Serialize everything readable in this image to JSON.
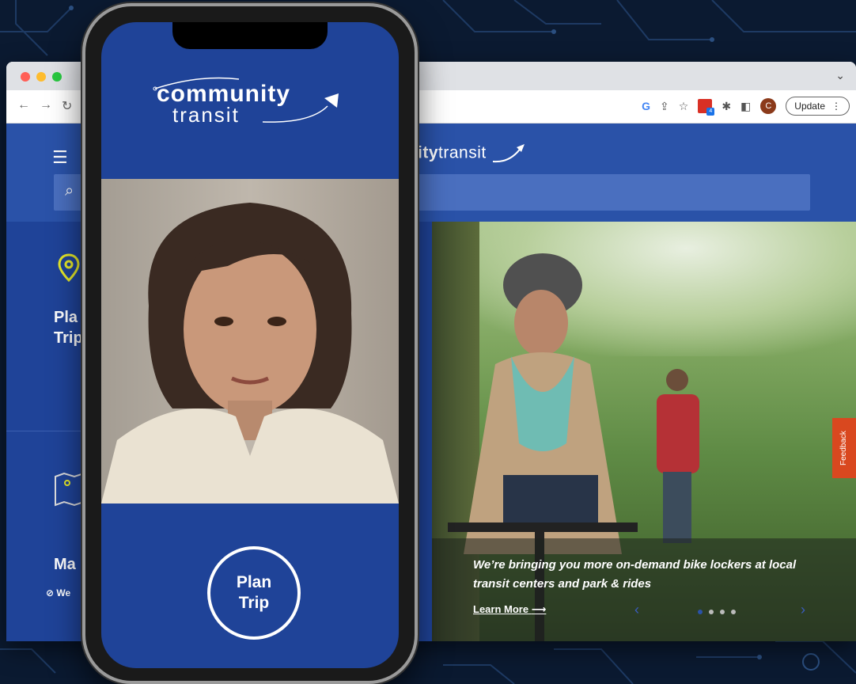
{
  "browser": {
    "toolbar": {
      "update_label": "Update",
      "avatar_letter": "C",
      "extension_badge": "4"
    }
  },
  "site": {
    "logo_bold": "ity",
    "logo_light": "transit",
    "cards": [
      {
        "label_line1": "Pla",
        "label_line2": "Trip",
        "icon": "map-pin-icon"
      },
      {
        "label_line1": "Ma",
        "icon": "map-icon",
        "link_text": "We"
      }
    ],
    "hero": {
      "caption": "We’re bringing you more on-demand bike lockers at local transit centers and park & rides",
      "learn_more": "Learn More",
      "learn_more_arrow": "⟶",
      "slides": 4,
      "active_slide": 1
    },
    "feedback_label": "Feedback"
  },
  "phone": {
    "logo_line1": "community",
    "logo_line2": "transit",
    "plan_trip_line1": "Plan",
    "plan_trip_line2": "Trip"
  },
  "colors": {
    "brand_blue": "#1f4398",
    "header_blue": "#2a52a8",
    "accent_yellow": "#e6e82a",
    "feedback_orange": "#d9481f"
  }
}
